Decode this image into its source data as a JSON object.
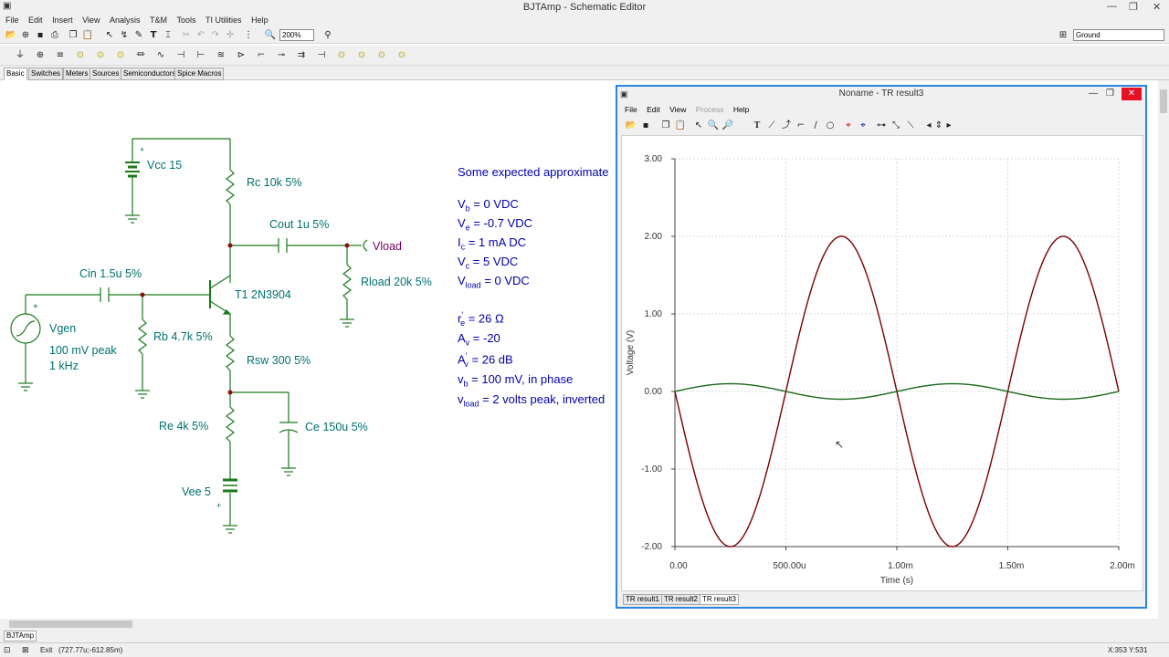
{
  "window": {
    "title": "BJTAmp - Schematic Editor",
    "min": "—",
    "max": "❐",
    "close": "✕"
  },
  "menu": [
    "File",
    "Edit",
    "Insert",
    "View",
    "Analysis",
    "T&M",
    "Tools",
    "TI Utilities",
    "Help"
  ],
  "toolbar": {
    "zoom": "200%",
    "ground_select": "Ground"
  },
  "tabs": [
    "Basic",
    "Switches",
    "Meters",
    "Sources",
    "Semiconductors",
    "Spice Macros"
  ],
  "schematic": {
    "vcc": "Vcc 15",
    "rc": "Rc 10k 5%",
    "cout": "Cout 1u 5%",
    "vload": "Vload",
    "rload": "Rload 20k 5%",
    "cin": "Cin 1.5u 5%",
    "t1": "T1 2N3904",
    "vgen": "Vgen",
    "vgen_amp": "100 mV peak",
    "vgen_freq": "1 kHz",
    "rb": "Rb 4.7k 5%",
    "rsw": "Rsw 300 5%",
    "re": "Re 4k 5%",
    "ce": "Ce 150u 5%",
    "vee": "Vee 5",
    "plus": "+"
  },
  "notes": {
    "heading": "Some expected approximate",
    "vb_sym": "V",
    "vb_sub": "b",
    "vb_val": "= 0 VDC",
    "ve_sym": "V",
    "ve_sub": "e",
    "ve_val": "= -0.7 VDC",
    "ic_sym": "I",
    "ic_sub": "c",
    "ic_val": "= 1 mA DC",
    "vc_sym": "V",
    "vc_sub": "c",
    "vc_val": "= 5 VDC",
    "vload_sym": "V",
    "vload_sub": "load",
    "vload_val": "= 0 VDC",
    "re_sym": "r",
    "re_sup": "'",
    "re_sub": "e",
    "re_val": "= 26 Ω",
    "av_sym": "A",
    "av_sub": "v",
    "av_val": "= -20",
    "avp_sym": "A",
    "avp_sup": "'",
    "avp_sub": "v",
    "avp_val": "= 26 dB",
    "vbs_sym": "v",
    "vbs_sub": "b",
    "vbs_val": "= 100 mV, in phase",
    "vls_sym": "v",
    "vls_sub": "load",
    "vls_val": "= 2 volts peak, inverted"
  },
  "result_window": {
    "title": "Noname - TR result3",
    "menu": [
      "File",
      "Edit",
      "View",
      "Process",
      "Help"
    ],
    "tabs": [
      "TR result1",
      "TR result2",
      "TR result3"
    ]
  },
  "chart_data": {
    "type": "line",
    "xlabel": "Time (s)",
    "ylabel": "Voltage (V)",
    "xlim": [
      0,
      0.002
    ],
    "ylim": [
      -2,
      3
    ],
    "x_ticks": [
      "0.00",
      "500.00u",
      "1.00m",
      "1.50m",
      "2.00m"
    ],
    "y_ticks": [
      "3.00",
      "2.00",
      "1.00",
      "0.00",
      "-1.00",
      "-2.00"
    ],
    "grid": true,
    "series": [
      {
        "color": "#7a0000",
        "amplitude": 2.0,
        "frequency_hz": 1000,
        "phase": "inverted"
      },
      {
        "color": "#1a6a1a",
        "amplitude": 0.1,
        "frequency_hz": 1000,
        "phase": "in phase"
      }
    ]
  },
  "status": {
    "exit": "Exit",
    "coords": "(727.77u;-612.85m)",
    "cursor": "X:353  Y:531",
    "bottom_tab": "BJTAmp"
  }
}
